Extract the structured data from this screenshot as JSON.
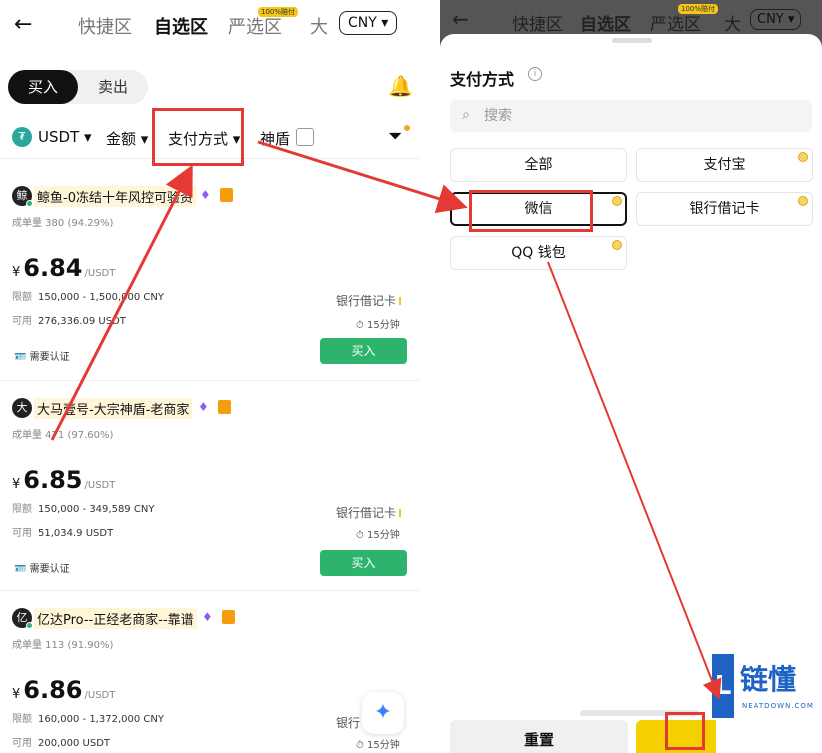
{
  "left": {
    "tabs": [
      "快捷区",
      "自选区",
      "严选区",
      "大"
    ],
    "tab_badge": "100%赔付",
    "currency": "CNY",
    "segment": {
      "buy": "买入",
      "sell": "卖出"
    },
    "filters": {
      "asset": "USDT",
      "amount": "金额",
      "payment": "支付方式",
      "shield": "神盾"
    },
    "merchants": [
      {
        "avatar": "鲸",
        "name": "鲸鱼-0冻结十年风控可验资",
        "orders": "成单量 380 (94.29%)",
        "yen": "¥",
        "price": "6.84",
        "unit": "/USDT",
        "limit_label": "限额",
        "limit": "150,000 - 1,500,000 CNY",
        "avail_label": "可用",
        "avail": "276,336.09 USDT",
        "payment": "银行借记卡",
        "time": "15分钟",
        "verify": "需要认证",
        "action": "买入"
      },
      {
        "avatar": "大",
        "name": "大马壹号-大宗神盾-老商家",
        "orders": "成单量 471 (97.60%)",
        "yen": "¥",
        "price": "6.85",
        "unit": "/USDT",
        "limit_label": "限额",
        "limit": "150,000 - 349,589 CNY",
        "avail_label": "可用",
        "avail": "51,034.9 USDT",
        "payment": "银行借记卡",
        "time": "15分钟",
        "verify": "需要认证",
        "action": "买入"
      },
      {
        "avatar": "亿",
        "name": "亿达Pro--正经老商家--靠谱",
        "orders": "成单量 113 (91.90%)",
        "yen": "¥",
        "price": "6.86",
        "unit": "/USDT",
        "limit_label": "限额",
        "limit": "160,000 - 1,372,000 CNY",
        "avail_label": "可用",
        "avail": "200,000 USDT",
        "payment": "银行",
        "time": "15分钟"
      }
    ]
  },
  "right": {
    "tabs": [
      "快捷区",
      "自选区",
      "严选区",
      "大"
    ],
    "tab_badge": "100%赔付",
    "currency": "CNY",
    "sheet_title": "支付方式",
    "search_placeholder": "搜索",
    "options": [
      "全部",
      "支付宝",
      "微信",
      "银行借记卡",
      "QQ 钱包"
    ],
    "reset": "重置",
    "watermark": {
      "brand": "链懂",
      "letter": "L",
      "site": "NEATDOWN.COM"
    }
  },
  "colors": {
    "accent_green": "#2db36b",
    "annotation_red": "#e53935",
    "brand_yellow": "#f5d000",
    "watermark_blue": "#1e63c4"
  }
}
